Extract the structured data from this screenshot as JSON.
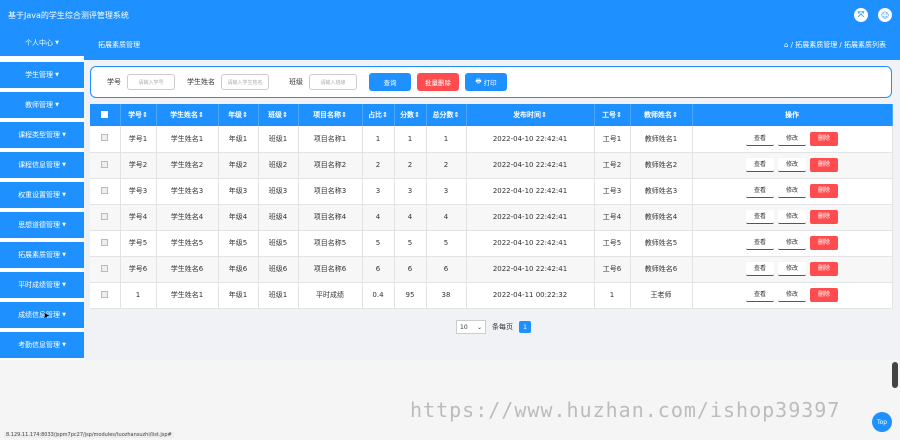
{
  "header": {
    "title": "基于Java的学生综合测评管理系统"
  },
  "sidebar": {
    "items": [
      {
        "label": "个人中心"
      },
      {
        "label": "学生管理"
      },
      {
        "label": "教师管理"
      },
      {
        "label": "课程类型管理"
      },
      {
        "label": "课程信息管理"
      },
      {
        "label": "权重设置管理"
      },
      {
        "label": "思想道德管理"
      },
      {
        "label": "拓展素质管理"
      },
      {
        "label": "平时成绩管理"
      },
      {
        "label": "成绩信息管理"
      },
      {
        "label": "考勤信息管理"
      }
    ]
  },
  "subhead": {
    "title": "拓展素质管理",
    "breadcrumb": "⌂ / 拓展素质管理 / 拓展素质列表"
  },
  "search": {
    "student_no_label": "学号",
    "student_no_placeholder": "请输入学号",
    "student_name_label": "学生姓名",
    "student_name_placeholder": "请输入学生姓名",
    "class_label": "班级",
    "class_placeholder": "请输入班级",
    "query_button": "查询",
    "batch_delete_button": "批量删除",
    "print_button": "打印"
  },
  "table": {
    "columns": [
      "学号",
      "学生姓名",
      "年级",
      "班级",
      "项目名称",
      "占比",
      "分数",
      "总分数",
      "发布时间",
      "工号",
      "教师姓名",
      "操作"
    ],
    "rows": [
      [
        "学号1",
        "学生姓名1",
        "年级1",
        "班级1",
        "项目名称1",
        "1",
        "1",
        "1",
        "2022-04-10 22:42:41",
        "工号1",
        "教师姓名1"
      ],
      [
        "学号2",
        "学生姓名2",
        "年级2",
        "班级2",
        "项目名称2",
        "2",
        "2",
        "2",
        "2022-04-10 22:42:41",
        "工号2",
        "教师姓名2"
      ],
      [
        "学号3",
        "学生姓名3",
        "年级3",
        "班级3",
        "项目名称3",
        "3",
        "3",
        "3",
        "2022-04-10 22:42:41",
        "工号3",
        "教师姓名3"
      ],
      [
        "学号4",
        "学生姓名4",
        "年级4",
        "班级4",
        "项目名称4",
        "4",
        "4",
        "4",
        "2022-04-10 22:42:41",
        "工号4",
        "教师姓名4"
      ],
      [
        "学号5",
        "学生姓名5",
        "年级5",
        "班级5",
        "项目名称5",
        "5",
        "5",
        "5",
        "2022-04-10 22:42:41",
        "工号5",
        "教师姓名5"
      ],
      [
        "学号6",
        "学生姓名6",
        "年级6",
        "班级6",
        "项目名称6",
        "6",
        "6",
        "6",
        "2022-04-10 22:42:41",
        "工号6",
        "教师姓名6"
      ],
      [
        "1",
        "学生姓名1",
        "年级1",
        "班级1",
        "平时成绩",
        "0.4",
        "95",
        "38",
        "2022-04-11 00:22:32",
        "1",
        "王老师"
      ]
    ],
    "actions": {
      "view": "查看",
      "edit": "修改",
      "delete": "删除"
    }
  },
  "pager": {
    "page_size": "10",
    "per_page_label": "条每页",
    "current_page": "1"
  },
  "status_url": "8.129.11.174:8033/jspm7pc27/jsp/modules/tuozhansuzhi/list.jsp#",
  "watermark": "https://www.huzhan.com/ishop39397",
  "top_button": "Top",
  "colors": {
    "primary": "#1e90ff",
    "danger": "#ff4d4f"
  }
}
